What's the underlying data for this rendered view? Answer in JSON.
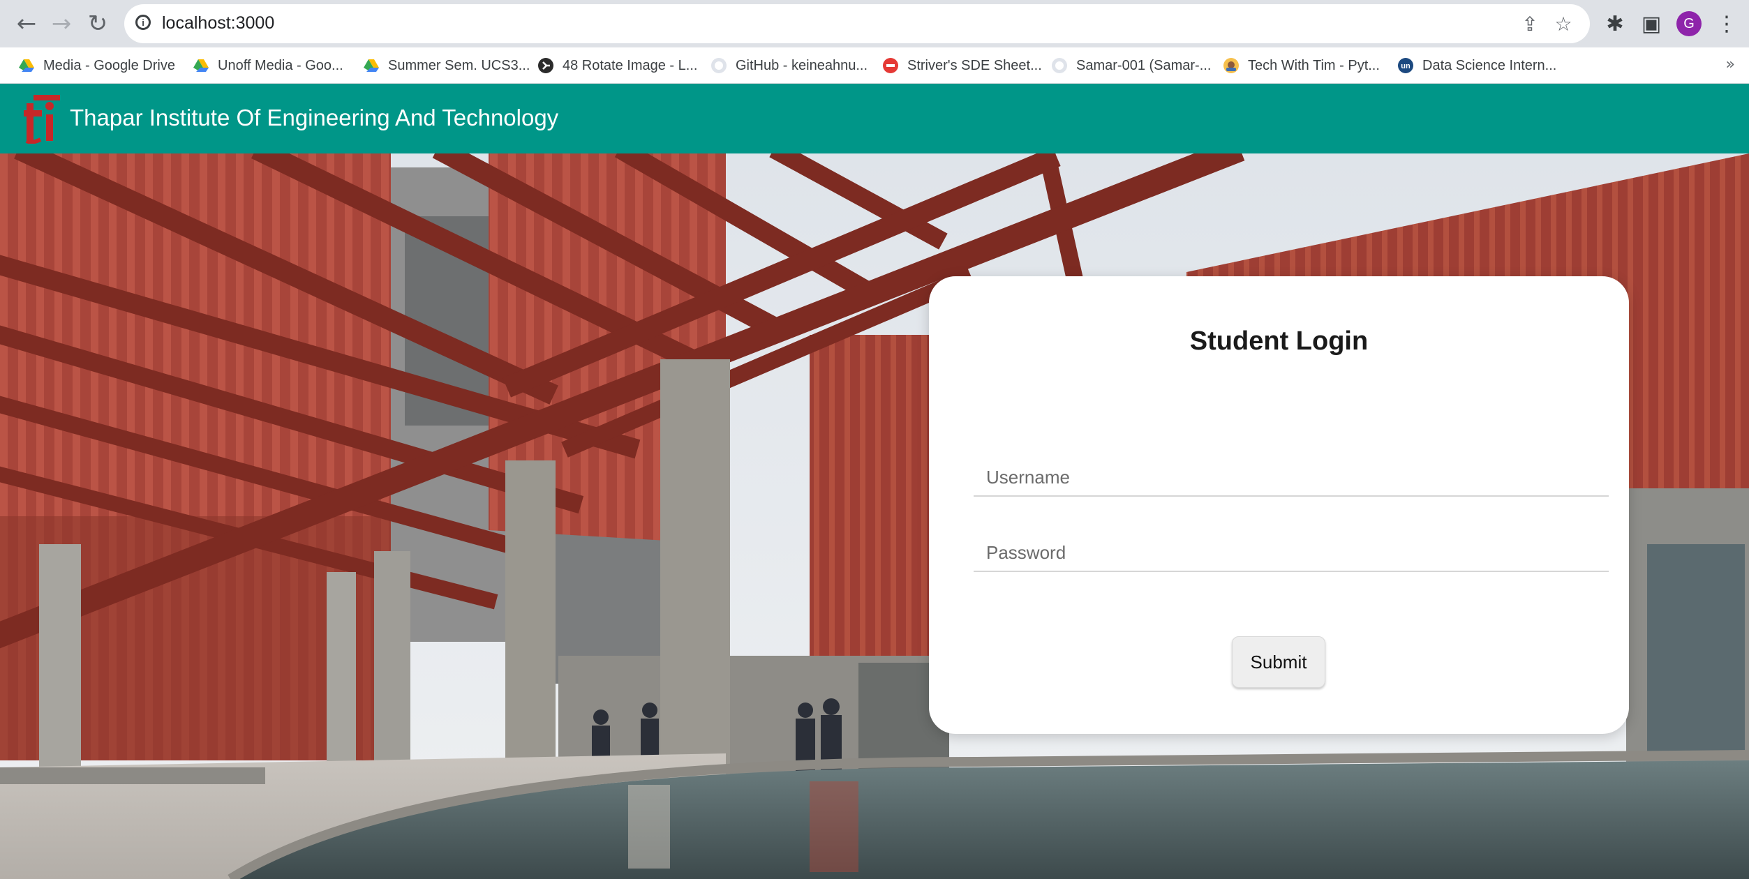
{
  "browser": {
    "url": "localhost:3000",
    "bookmarks": [
      {
        "label": "Media - Google Drive",
        "icon": "google-drive-icon"
      },
      {
        "label": "Unoff Media - Goo...",
        "icon": "google-drive-icon"
      },
      {
        "label": "Summer Sem. UCS3...",
        "icon": "google-drive-icon"
      },
      {
        "label": "48 Rotate Image - L...",
        "icon": "leetcode-icon"
      },
      {
        "label": "GitHub - keineahnu...",
        "icon": "github-icon"
      },
      {
        "label": "Striver's SDE Sheet...",
        "icon": "tuf-icon"
      },
      {
        "label": "Samar-001 (Samar-...",
        "icon": "github-icon"
      },
      {
        "label": "Tech With Tim - Pyt...",
        "icon": "tech-with-tim-icon"
      },
      {
        "label": "Data Science Intern...",
        "icon": "unstop-icon"
      }
    ],
    "profile_initial": "G",
    "more_bookmarks": "»"
  },
  "header": {
    "title": "Thapar Institute Of Engineering And Technology",
    "logo_text": "ti"
  },
  "login": {
    "title": "Student Login",
    "username_placeholder": "Username",
    "username_value": "",
    "password_placeholder": "Password",
    "password_value": "",
    "submit_label": "Submit"
  },
  "colors": {
    "header": "#009688",
    "logo": "#c62828",
    "card": "#ffffff",
    "profile": "#8e24aa"
  }
}
